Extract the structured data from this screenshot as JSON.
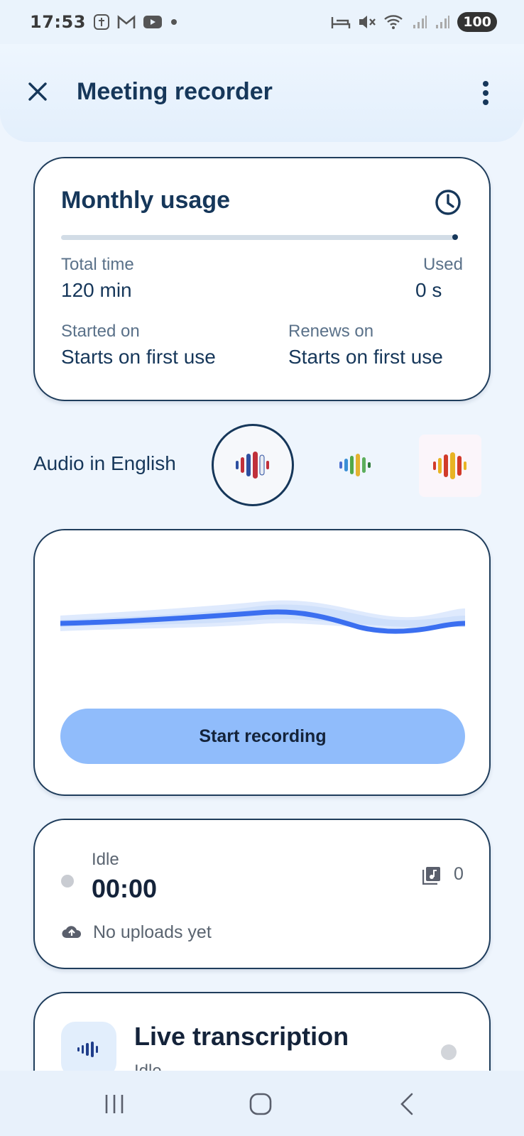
{
  "status_bar": {
    "time": "17:53",
    "battery": "100",
    "icons": [
      "tplus-icon",
      "gmail-icon",
      "youtube-icon",
      "dot-icon",
      "sleep-icon",
      "mute-icon",
      "wifi-icon",
      "signal-icon",
      "signal-icon"
    ]
  },
  "header": {
    "title": "Meeting recorder",
    "close_icon": "close-icon",
    "menu_icon": "more-vertical-icon"
  },
  "usage": {
    "title": "Monthly usage",
    "progress_used_fraction": 0.0,
    "total_time_label": "Total time",
    "total_time_value": "120 min",
    "used_label": "Used",
    "used_value": "0 s",
    "started_label": "Started on",
    "started_value": "Starts on first use",
    "renews_label": "Renews on",
    "renews_value": "Starts on first use"
  },
  "language": {
    "label": "Audio in English",
    "options": [
      "English audio icon",
      "Multilingual audio icon",
      "Spanish audio icon"
    ],
    "selected_index": 0
  },
  "recorder": {
    "start_label": "Start recording"
  },
  "status": {
    "state": "Idle",
    "timer": "00:00",
    "uploads_text": "No uploads yet",
    "clip_count": "0"
  },
  "live": {
    "title": "Live transcription",
    "state": "Idle"
  },
  "colors": {
    "primary": "#16375a",
    "button": "#90bcfb",
    "wave": "#3b6ff0",
    "background": "#eef5fd"
  }
}
